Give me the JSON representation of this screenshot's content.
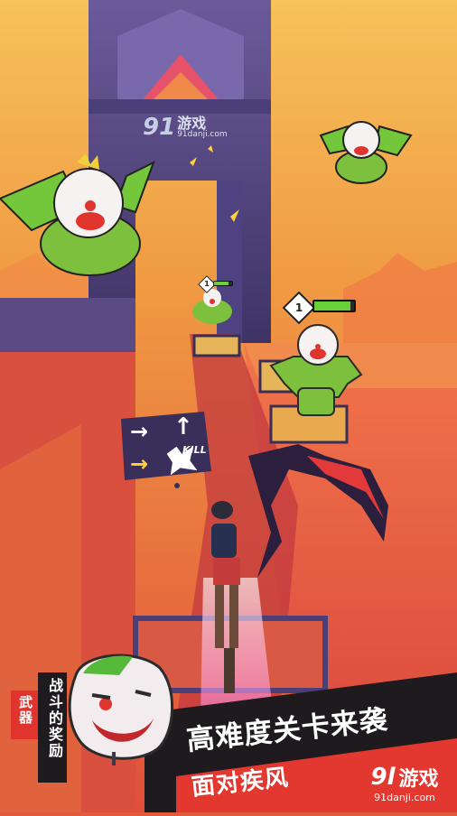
{
  "watermark_top": {
    "logo": "91",
    "name": "游戏",
    "url": "91danji.com"
  },
  "hud": {
    "enemy_far_level": "1",
    "enemy_near_level": "1",
    "enemy_far_hp": 0.8,
    "enemy_near_hp": 0.9
  },
  "combo_bubble": {
    "arrows": [
      "→",
      "↑",
      "→"
    ],
    "kill_label": "KILL"
  },
  "reward_panel": {
    "tag": "武器",
    "subtitle": "战斗的奖励"
  },
  "promo": {
    "headline": "高难度关卡来袭",
    "subline": "面对疾风"
  },
  "watermark_bottom": {
    "logo": "9l",
    "name": "游戏",
    "url": "91danji.com"
  },
  "colors": {
    "sky_top": "#f4b24a",
    "sky_bottom": "#e5573a",
    "tower": "#5c4a86",
    "accent_green": "#6ad03a",
    "reward_red": "#e0342e"
  }
}
